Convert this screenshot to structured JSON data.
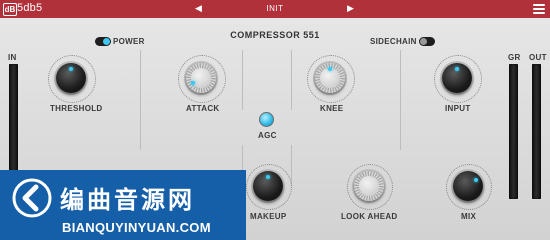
{
  "titlebar": {
    "logo_text": "dB",
    "brand": "5db5",
    "prev_arrow": "◀",
    "next_arrow": "▶",
    "preset": "INIT"
  },
  "panel": {
    "title": "COMPRESSOR 551",
    "power_label": "POWER",
    "sidechain_label": "SIDECHAIN",
    "agc_label": "AGC",
    "in_label": "IN",
    "gr_label": "GR",
    "out_label": "OUT",
    "knobs": {
      "threshold": "THRESHOLD",
      "attack": "ATTACK",
      "knee": "KNEE",
      "input": "INPUT",
      "makeup": "MAKEUP",
      "look_ahead": "LOOK AHEAD",
      "mix": "MIX"
    }
  },
  "banner": {
    "cn_text": "编曲音源网",
    "url": "BIANQUYINYUAN.COM"
  },
  "colors": {
    "titlebar": "#b0313a",
    "accent": "#3ec8f0",
    "banner": "#155ea8"
  }
}
